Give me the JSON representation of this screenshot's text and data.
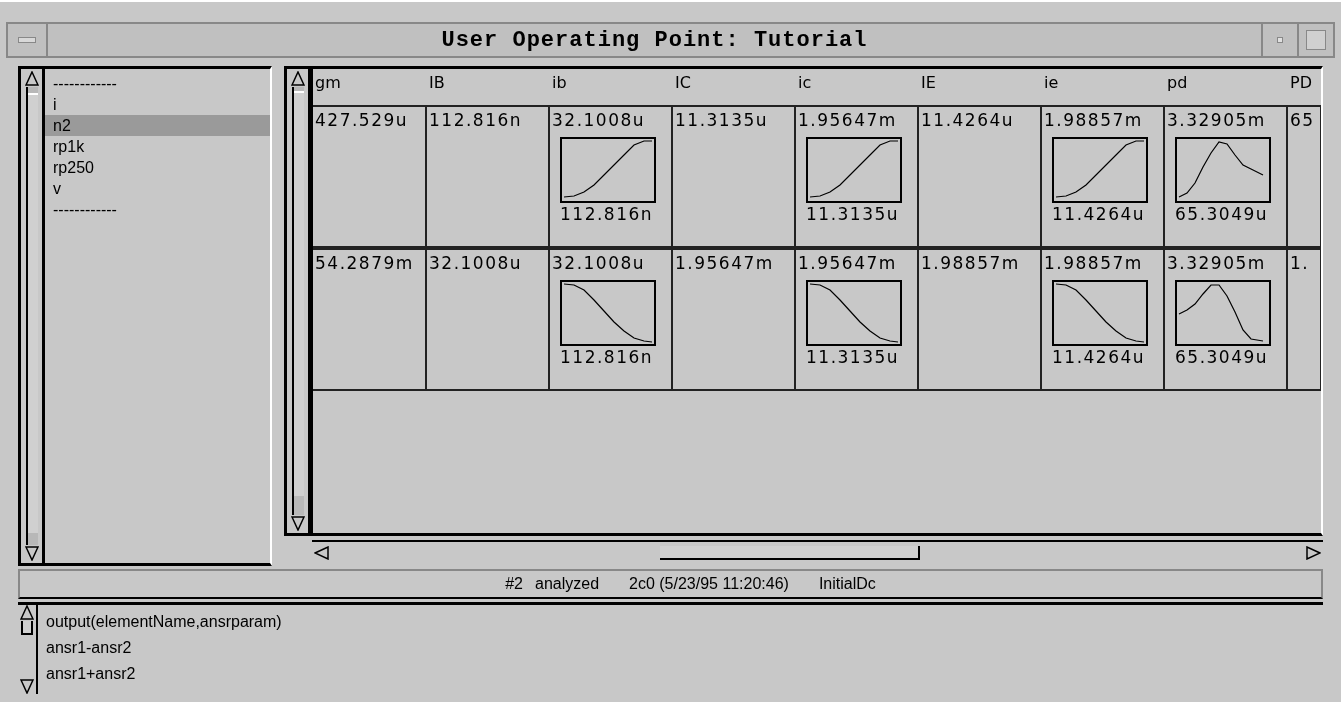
{
  "window": {
    "title": "User Operating Point: Tutorial"
  },
  "list": {
    "items": [
      {
        "label": "------------",
        "selected": false
      },
      {
        "label": "i",
        "selected": false
      },
      {
        "label": "n2",
        "selected": true
      },
      {
        "label": "rp1k",
        "selected": false
      },
      {
        "label": "rp250",
        "selected": false
      },
      {
        "label": "v",
        "selected": false
      },
      {
        "label": "------------",
        "selected": false
      }
    ]
  },
  "table": {
    "columns": [
      "gm",
      "IB",
      "ib",
      "IC",
      "ic",
      "IE",
      "ie",
      "pd",
      "PD"
    ],
    "rows": [
      {
        "cells": [
          {
            "kind": "value",
            "value": "427.529u"
          },
          {
            "kind": "value",
            "value": "112.816n"
          },
          {
            "kind": "rise",
            "value": "32.1008u",
            "label": "112.816n"
          },
          {
            "kind": "value",
            "value": "11.3135u"
          },
          {
            "kind": "rise",
            "value": "1.95647m",
            "label": "11.3135u"
          },
          {
            "kind": "value",
            "value": "11.4264u"
          },
          {
            "kind": "rise",
            "value": "1.98857m",
            "label": "11.4264u"
          },
          {
            "kind": "peak",
            "value": "3.32905m",
            "label": "65.3049u"
          },
          {
            "kind": "value",
            "value": "65"
          }
        ]
      },
      {
        "cells": [
          {
            "kind": "value",
            "value": "54.2879m"
          },
          {
            "kind": "value",
            "value": "32.1008u"
          },
          {
            "kind": "fall",
            "value": "32.1008u",
            "label": "112.816n"
          },
          {
            "kind": "value",
            "value": "1.95647m"
          },
          {
            "kind": "fall",
            "value": "1.95647m",
            "label": "11.3135u"
          },
          {
            "kind": "value",
            "value": "1.98857m"
          },
          {
            "kind": "fall",
            "value": "1.98857m",
            "label": "11.4264u"
          },
          {
            "kind": "hump",
            "value": "3.32905m",
            "label": "65.3049u"
          },
          {
            "kind": "value",
            "value": "1."
          }
        ]
      }
    ]
  },
  "status_bar": [
    "#2",
    "analyzed",
    "2c0 (5/23/95 11:20:46)",
    "InitialDc"
  ],
  "output": {
    "lines": [
      "output(elementName,ansrparam)",
      "ansr1-ansr2",
      "ansr1+ansr2"
    ]
  }
}
